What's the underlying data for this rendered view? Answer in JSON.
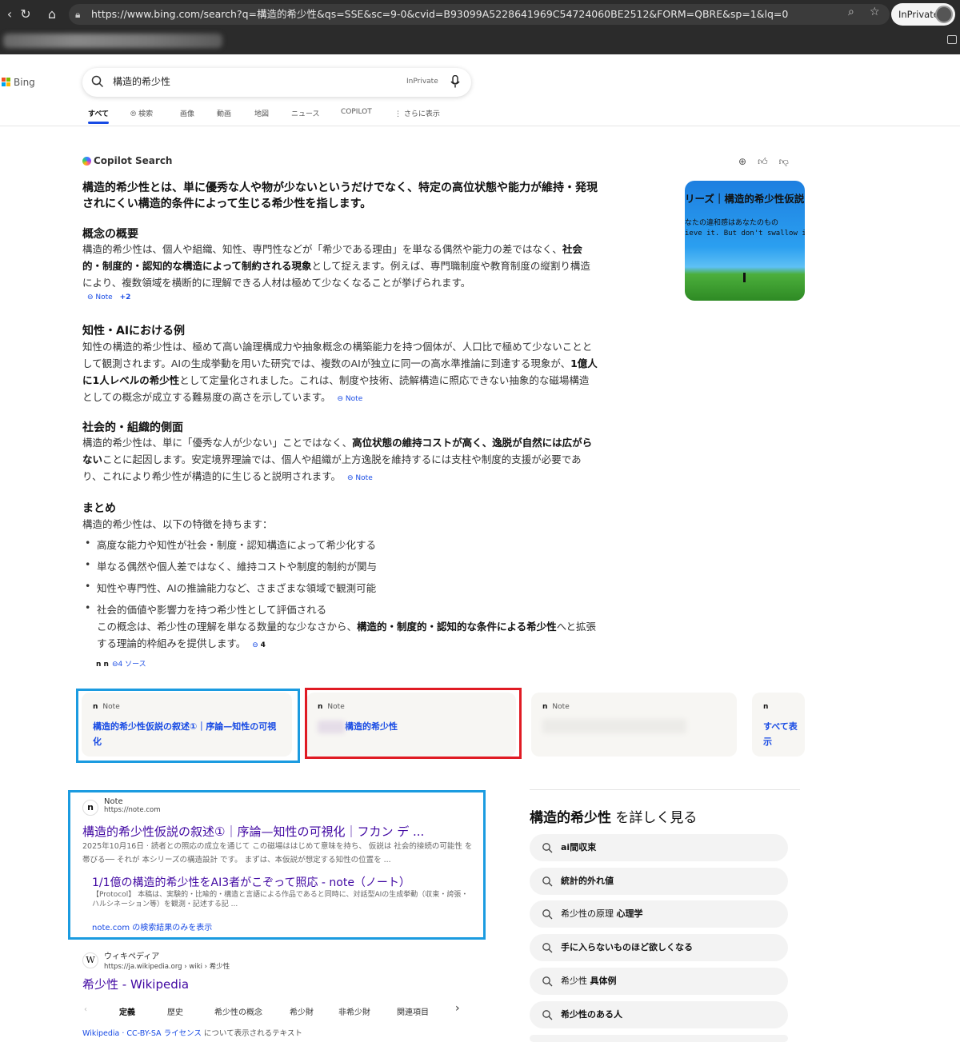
{
  "browser": {
    "url": "https://www.bing.com/search?q=構造的希少性&qs=SSE&sc=9-0&cvid=B93099A5228641969C54724060BE2512&FORM=QBRE&sp=1&lq=0",
    "inprivate": "InPrivate"
  },
  "bing": {
    "logo": "Bing",
    "query": "構造的希少性",
    "inprivate_badge": "InPrivate",
    "tabs": [
      "すべて",
      "検索",
      "画像",
      "動画",
      "地図",
      "ニュース",
      "COPILOT",
      "さらに表示"
    ]
  },
  "copilot": {
    "label": "Copilot Search",
    "lead": "構造的希少性とは、単に優秀な人や物が少ないというだけでなく、特定の高位状態や能力が維持・発現されにくい構造的条件によって生じる希少性を指します。",
    "sections": [
      {
        "heading": "概念の概要",
        "p1": "構造的希少性は、個人や組織、知性、専門性などが「希少である理由」を単なる偶然や能力の差ではなく、",
        "b1": "社会的・制度的・認知的な構造によって制約される現象",
        "p2": "として捉えます。例えば、専門職制度や教育制度の縦割り構造により、複数領域を横断的に理解できる人材は極めて少なくなることが挙げられます。",
        "cite": "Note",
        "cite_extra": "+2"
      },
      {
        "heading": "知性・AIにおける例",
        "p1": "知性の構造的希少性は、極めて高い論理構成力や抽象概念の構築能力を持つ個体が、人口比で極めて少ないこととして観測されます。AIの生成挙動を用いた研究では、複数のAIが独立に同一の高水準推論に到達する現象が、",
        "b1": "1億人に1人レベルの希少性",
        "p2": "として定量化されました。これは、制度や技術、読解構造に照応できない抽象的な磁場構造としての概念が成立する難易度の高さを示しています。",
        "cite": "Note"
      },
      {
        "heading": "社会的・組織的側面",
        "p1": "構造的希少性は、単に「優秀な人が少ない」ことではなく、",
        "b1": "高位状態の維持コストが高く、逸脱が自然には広がらない",
        "p2": "ことに起因します。安定境界理論では、個人や組織が上方逸脱を維持するには支柱や制度的支援が必要であり、これにより希少性が構造的に生じると説明されます。",
        "cite": "Note"
      }
    ],
    "summary_heading": "まとめ",
    "summary_intro": "構造的希少性は、以下の特徴を持ちます：",
    "bullets": [
      "高度な能力や知性が社会・制度・認知構造によって希少化する",
      "単なる偶然や個人差ではなく、維持コストや制度的制約が関与",
      "知性や専門性、AIの推論能力など、さまざまな領域で観測可能",
      "社会的価値や影響力を持つ希少性として評価される"
    ],
    "closing_p1": "この概念は、希少性の理解を単なる数量的な少なさから、",
    "closing_b1": "構造的・制度的・認知的な条件による希少性",
    "closing_p2": "へと拡張する理論的枠組みを提供します。",
    "closing_cite": "4",
    "sources_icons": "n n",
    "sources_label": "4 ソース",
    "feedback": [
      "plus-icon",
      "thumbs-up-icon",
      "thumbs-down-icon"
    ],
    "image_text1": "リーズ｜構造的希少性仮説",
    "image_text2": "なたの違和感はあなたのもの",
    "image_text3": "ieve it. But don't swallow it wh"
  },
  "source_cards": [
    {
      "site": "Note",
      "title": "構造的希少性仮説の叙述①｜序論—知性の可視化"
    },
    {
      "site": "Note",
      "title": "構造的希少性"
    },
    {
      "site": "Note",
      "title": ""
    },
    {
      "site": "",
      "title": "すべて表示"
    }
  ],
  "results": [
    {
      "site": "Note",
      "url": "https://note.com",
      "title": "構造的希少性仮説の叙述①｜序論—知性の可視化｜フカン デ ...",
      "snippet": "2025年10月16日 · 読者との照応の成立を通じて この磁場ははじめて意味を持ち、 仮説は 社会的接続の可能性 を帯びる── それが 本シリーズの構造設計 です。 まずは、本仮説が想定する知性の位置を ...",
      "sub_title": "1/1億の構造的希少性をAI3者がこぞって照応 - note（ノート）",
      "sub_snippet": "【Protocol】 本稿は、実験的・比喩的・構造と言語による作品であると同時に、対話型AIの生成挙動（収束・誇張・ハルシネーション等）を観測・記述する記 ...",
      "more": "note.com の検索結果のみを表示"
    },
    {
      "site": "ウィキペディア",
      "url": "https://ja.wikipedia.org › wiki › 希少性",
      "title": "希少性 - Wikipedia",
      "tabs": [
        "定義",
        "歴史",
        "希少性の概念",
        "希少財",
        "非希少財",
        "関連項目"
      ],
      "license_prefix": "Wikipedia · ",
      "license_link": "CC-BY-SA ライセンス",
      "license_suffix": " について表示されるテキスト"
    }
  ],
  "related": {
    "title_bold": "構造的希少性",
    "title_rest": " を詳しく見る",
    "items": [
      {
        "pre": "",
        "bold": "ai間収束"
      },
      {
        "pre": "",
        "bold": "統計的外れ値"
      },
      {
        "pre": "希少性の原理 ",
        "bold": "心理学"
      },
      {
        "pre": "",
        "bold": "手に入らないものほど欲しくなる"
      },
      {
        "pre": "希少性 ",
        "bold": "具体例"
      },
      {
        "pre": "",
        "bold": "希少性のある人"
      }
    ]
  },
  "colors": {
    "link": "#174ae4",
    "visited": "#4007a2",
    "highlight_blue": "#1b9be0",
    "highlight_red": "#e01b24"
  }
}
